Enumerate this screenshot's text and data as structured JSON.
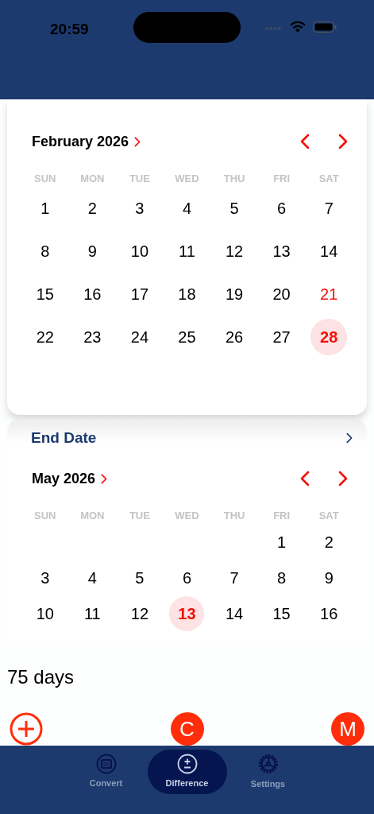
{
  "status_bar": {
    "time": "20:59"
  },
  "start_calendar": {
    "month": "February 2026",
    "weekdays": [
      "SUN",
      "MON",
      "TUE",
      "WED",
      "THU",
      "FRI",
      "SAT"
    ],
    "weeks": [
      [
        {
          "kind": "day",
          "day": "1",
          "selected": false,
          "highlighted": false
        },
        {
          "kind": "day",
          "day": "2",
          "selected": false,
          "highlighted": false
        },
        {
          "kind": "day",
          "day": "3",
          "selected": false,
          "highlighted": false
        },
        {
          "kind": "day",
          "day": "4",
          "selected": false,
          "highlighted": false
        },
        {
          "kind": "day",
          "day": "5",
          "selected": false,
          "highlighted": false
        },
        {
          "kind": "day",
          "day": "6",
          "selected": false,
          "highlighted": false
        },
        {
          "kind": "day",
          "day": "7",
          "selected": false,
          "highlighted": false
        }
      ],
      [
        {
          "kind": "day",
          "day": "8",
          "selected": false,
          "highlighted": false
        },
        {
          "kind": "day",
          "day": "9",
          "selected": false,
          "highlighted": false
        },
        {
          "kind": "day",
          "day": "10",
          "selected": false,
          "highlighted": false
        },
        {
          "kind": "day",
          "day": "11",
          "selected": false,
          "highlighted": false
        },
        {
          "kind": "day",
          "day": "12",
          "selected": false,
          "highlighted": false
        },
        {
          "kind": "day",
          "day": "13",
          "selected": false,
          "highlighted": false
        },
        {
          "kind": "day",
          "day": "14",
          "selected": false,
          "highlighted": false
        }
      ],
      [
        {
          "kind": "day",
          "day": "15",
          "selected": false,
          "highlighted": false
        },
        {
          "kind": "day",
          "day": "16",
          "selected": false,
          "highlighted": false
        },
        {
          "kind": "day",
          "day": "17",
          "selected": false,
          "highlighted": false
        },
        {
          "kind": "day",
          "day": "18",
          "selected": false,
          "highlighted": false
        },
        {
          "kind": "day",
          "day": "19",
          "selected": false,
          "highlighted": false
        },
        {
          "kind": "day",
          "day": "20",
          "selected": false,
          "highlighted": false
        },
        {
          "kind": "day",
          "day": "21",
          "selected": false,
          "highlighted": true
        }
      ],
      [
        {
          "kind": "day",
          "day": "22",
          "selected": false,
          "highlighted": false
        },
        {
          "kind": "day",
          "day": "23",
          "selected": false,
          "highlighted": false
        },
        {
          "kind": "day",
          "day": "24",
          "selected": false,
          "highlighted": false
        },
        {
          "kind": "day",
          "day": "25",
          "selected": false,
          "highlighted": false
        },
        {
          "kind": "day",
          "day": "26",
          "selected": false,
          "highlighted": false
        },
        {
          "kind": "day",
          "day": "27",
          "selected": false,
          "highlighted": false
        },
        {
          "kind": "day",
          "day": "28",
          "selected": true,
          "highlighted": true
        }
      ]
    ]
  },
  "end_calendar": {
    "title": "End Date",
    "month": "May 2026",
    "weekdays": [
      "SUN",
      "MON",
      "TUE",
      "WED",
      "THU",
      "FRI",
      "SAT"
    ],
    "weeks": [
      [
        {
          "kind": "blank"
        },
        {
          "kind": "blank"
        },
        {
          "kind": "blank"
        },
        {
          "kind": "blank"
        },
        {
          "kind": "blank"
        },
        {
          "kind": "day",
          "day": "1",
          "selected": false,
          "highlighted": false
        },
        {
          "kind": "day",
          "day": "2",
          "selected": false,
          "highlighted": false
        }
      ],
      [
        {
          "kind": "day",
          "day": "3",
          "selected": false,
          "highlighted": false
        },
        {
          "kind": "day",
          "day": "4",
          "selected": false,
          "highlighted": false
        },
        {
          "kind": "day",
          "day": "5",
          "selected": false,
          "highlighted": false
        },
        {
          "kind": "day",
          "day": "6",
          "selected": false,
          "highlighted": false
        },
        {
          "kind": "day",
          "day": "7",
          "selected": false,
          "highlighted": false
        },
        {
          "kind": "day",
          "day": "8",
          "selected": false,
          "highlighted": false
        },
        {
          "kind": "day",
          "day": "9",
          "selected": false,
          "highlighted": false
        }
      ],
      [
        {
          "kind": "day",
          "day": "10",
          "selected": false,
          "highlighted": false
        },
        {
          "kind": "day",
          "day": "11",
          "selected": false,
          "highlighted": false
        },
        {
          "kind": "day",
          "day": "12",
          "selected": false,
          "highlighted": false
        },
        {
          "kind": "day",
          "day": "13",
          "selected": true,
          "highlighted": true
        },
        {
          "kind": "day",
          "day": "14",
          "selected": false,
          "highlighted": false
        },
        {
          "kind": "day",
          "day": "15",
          "selected": false,
          "highlighted": false
        },
        {
          "kind": "day",
          "day": "16",
          "selected": false,
          "highlighted": false
        }
      ]
    ]
  },
  "result": "75 days",
  "actions": [
    {
      "kind": "add"
    },
    {
      "kind": "letter",
      "label": "C"
    },
    {
      "kind": "letter",
      "label": "M"
    }
  ],
  "tabs": [
    {
      "label": "Convert",
      "kind": "calendar",
      "selected": false
    },
    {
      "label": "Difference",
      "kind": "plusminus",
      "selected": true
    },
    {
      "label": "Settings",
      "kind": "gear",
      "selected": false
    }
  ]
}
